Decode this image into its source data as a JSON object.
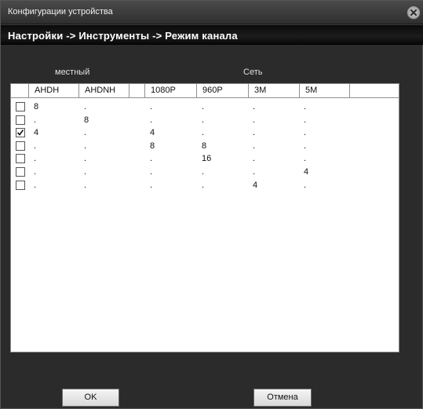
{
  "window": {
    "title": "Конфигурации устройства"
  },
  "breadcrumb": "Настройки -> Инструменты -> Режим канала",
  "groups": {
    "local": "местный",
    "network": "Сеть"
  },
  "table": {
    "columns": [
      "AHDH",
      "AHDNH",
      "1080P",
      "960P",
      "3M",
      "5M"
    ],
    "rows": [
      {
        "checked": false,
        "values": [
          "8",
          ".",
          ".",
          ".",
          ".",
          "."
        ]
      },
      {
        "checked": false,
        "values": [
          ".",
          "8",
          ".",
          ".",
          ".",
          "."
        ]
      },
      {
        "checked": true,
        "values": [
          "4",
          ".",
          "4",
          ".",
          ".",
          "."
        ]
      },
      {
        "checked": false,
        "values": [
          ".",
          ".",
          "8",
          "8",
          ".",
          "."
        ]
      },
      {
        "checked": false,
        "values": [
          ".",
          ".",
          ".",
          "16",
          ".",
          "."
        ]
      },
      {
        "checked": false,
        "values": [
          ".",
          ".",
          ".",
          ".",
          ".",
          "4"
        ]
      },
      {
        "checked": false,
        "values": [
          ".",
          ".",
          ".",
          ".",
          "4",
          "."
        ]
      }
    ]
  },
  "buttons": {
    "ok": "OK",
    "cancel": "Отмена"
  }
}
